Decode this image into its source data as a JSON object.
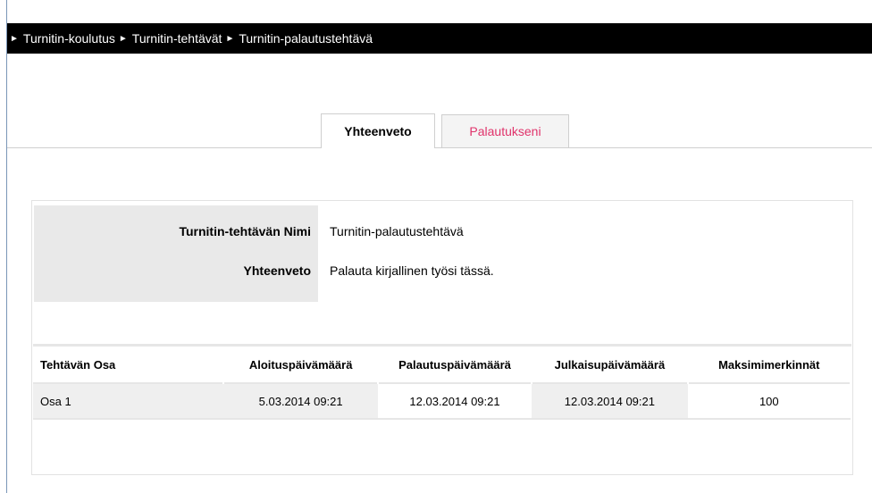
{
  "breadcrumb": {
    "items": [
      {
        "label": "Turnitin-koulutus"
      },
      {
        "label": "Turnitin-tehtävät"
      },
      {
        "label": "Turnitin-palautustehtävä"
      }
    ],
    "separator": "►"
  },
  "tabs": [
    {
      "label": "Yhteenveto",
      "active": true
    },
    {
      "label": "Palautukseni",
      "active": false
    }
  ],
  "summary": {
    "name_label": "Turnitin-tehtävän Nimi",
    "name_value": "Turnitin-palautustehtävä",
    "summary_label": "Yhteenveto",
    "summary_value": "Palauta kirjallinen työsi tässä."
  },
  "parts_table": {
    "columns": [
      "Tehtävän Osa",
      "Aloituspäivämäärä",
      "Palautuspäivämäärä",
      "Julkaisupäivämäärä",
      "Maksimimerkinnät"
    ],
    "rows": [
      [
        "Osa 1",
        "5.03.2014 09:21",
        "12.03.2014 09:21",
        "12.03.2014 09:21",
        "100"
      ]
    ]
  },
  "colors": {
    "breadcrumb_bg": "#000000",
    "inactive_tab_text": "#e0336b",
    "summary_bg": "#e9e9e9"
  }
}
